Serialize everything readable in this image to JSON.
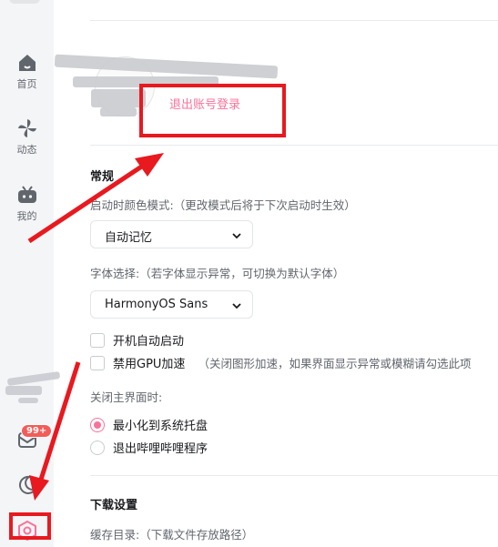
{
  "sidebar": {
    "items": [
      {
        "label": "首页",
        "icon": "home-icon"
      },
      {
        "label": "动态",
        "icon": "pinwheel-icon"
      },
      {
        "label": "我的",
        "icon": "tv-icon"
      }
    ],
    "bottom": {
      "message_badge": "99+",
      "message_icon": "message-icon",
      "theme_icon": "moon-icon",
      "settings_icon": "settings-icon"
    }
  },
  "account": {
    "logout_label": "退出账号登录"
  },
  "general": {
    "title": "常规",
    "color_mode_label": "启动时颜色模式:（更改模式后将于下次启动时生效）",
    "color_mode_value": "自动记忆",
    "font_label": "字体选择:（若字体显示异常，可切换为默认字体）",
    "font_value": "HarmonyOS Sans",
    "autostart_label": "开机自动启动",
    "gpu_label": "禁用GPU加速",
    "gpu_note": "（关闭图形加速，如果界面显示异常或模糊请勾选此项",
    "close_label": "关闭主界面时:",
    "close_options": [
      {
        "label": "最小化到系统托盘",
        "selected": true
      },
      {
        "label": "退出哔哩哔哩程序",
        "selected": false
      }
    ]
  },
  "download": {
    "title": "下载设置",
    "cache_label": "缓存目录:（下载文件存放路径）"
  },
  "colors": {
    "accent": "#fb7299",
    "annotation": "#e8191f"
  }
}
